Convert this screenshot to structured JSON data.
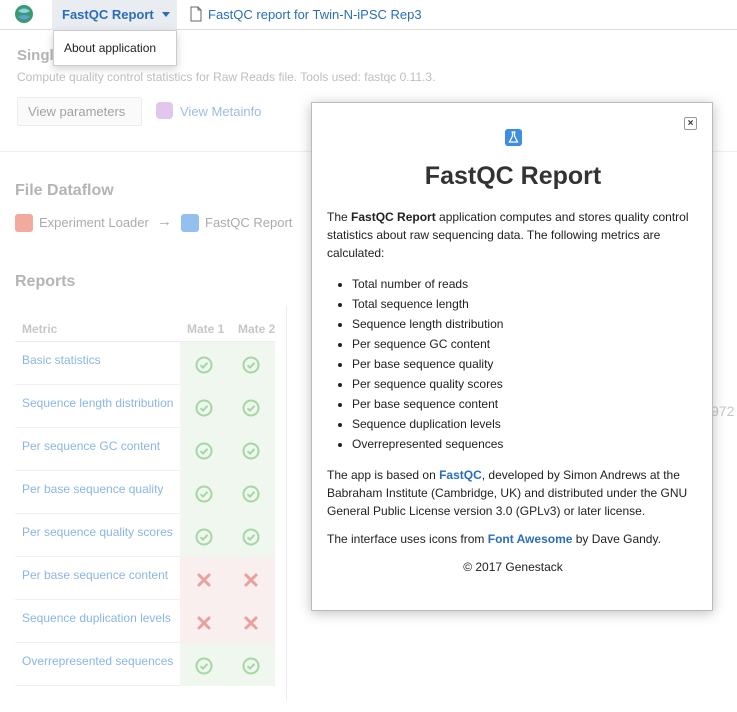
{
  "topbar": {
    "app_menu_label": "FastQC Report",
    "doc_title": "FastQC report for Twin-N-iPSC Rep3",
    "dropdown_item": "About application"
  },
  "header": {
    "title": "Singl",
    "description": "Compute quality control statistics for Raw Reads file. Tools used: fastqc 0.11.3.",
    "view_params": "View parameters",
    "view_metainfo": "View Metainfo"
  },
  "dataflow": {
    "title": "File Dataflow",
    "source": "Experiment Loader",
    "arrow": "→",
    "target": "FastQC Report"
  },
  "reports": {
    "title": "Reports",
    "columns": [
      "Metric",
      "Mate 1",
      "Mate 2"
    ],
    "rows": [
      {
        "label": "Basic statistics",
        "mate1": "pass",
        "mate2": "pass"
      },
      {
        "label": "Sequence length distribution",
        "mate1": "pass",
        "mate2": "pass"
      },
      {
        "label": "Per sequence GC content",
        "mate1": "pass",
        "mate2": "pass"
      },
      {
        "label": "Per base sequence quality",
        "mate1": "pass",
        "mate2": "pass"
      },
      {
        "label": "Per sequence quality scores",
        "mate1": "pass",
        "mate2": "pass"
      },
      {
        "label": "Per base sequence content",
        "mate1": "fail",
        "mate2": "fail"
      },
      {
        "label": "Sequence duplication levels",
        "mate1": "fail",
        "mate2": "fail"
      },
      {
        "label": "Overrepresented sequences",
        "mate1": "pass",
        "mate2": "pass"
      }
    ],
    "side_number": "972"
  },
  "modal": {
    "close": "×",
    "title": "FastQC Report",
    "intro_prefix": "The ",
    "intro_app": "FastQC Report",
    "intro_rest": " application computes and stores quality control statistics about raw sequencing data. The following metrics are calculated:",
    "metrics": [
      "Total number of reads",
      "Total sequence length",
      "Sequence length distribution",
      "Per sequence GC content",
      "Per base sequence quality",
      "Per sequence quality scores",
      "Per base sequence content",
      "Sequence duplication levels",
      "Overrepresented sequences"
    ],
    "based_prefix": "The app is based on ",
    "based_link": "FastQC",
    "based_rest": ", developed by Simon Andrews at the Babraham Institute (Cambridge, UK) and distributed under the GNU General Public License version 3.0 (GPLv3) or later license.",
    "icons_prefix": "The interface uses icons from ",
    "icons_link": "Font Awesome",
    "icons_rest": " by Dave Gandy.",
    "copyright": "© 2017 Genestack"
  },
  "colors": {
    "link": "#2a6eb8",
    "pass_bg": "#e3f1e3",
    "fail_bg": "#f5e2e2",
    "pass_icon": "#5cb85c",
    "fail_icon": "#d9534f"
  }
}
